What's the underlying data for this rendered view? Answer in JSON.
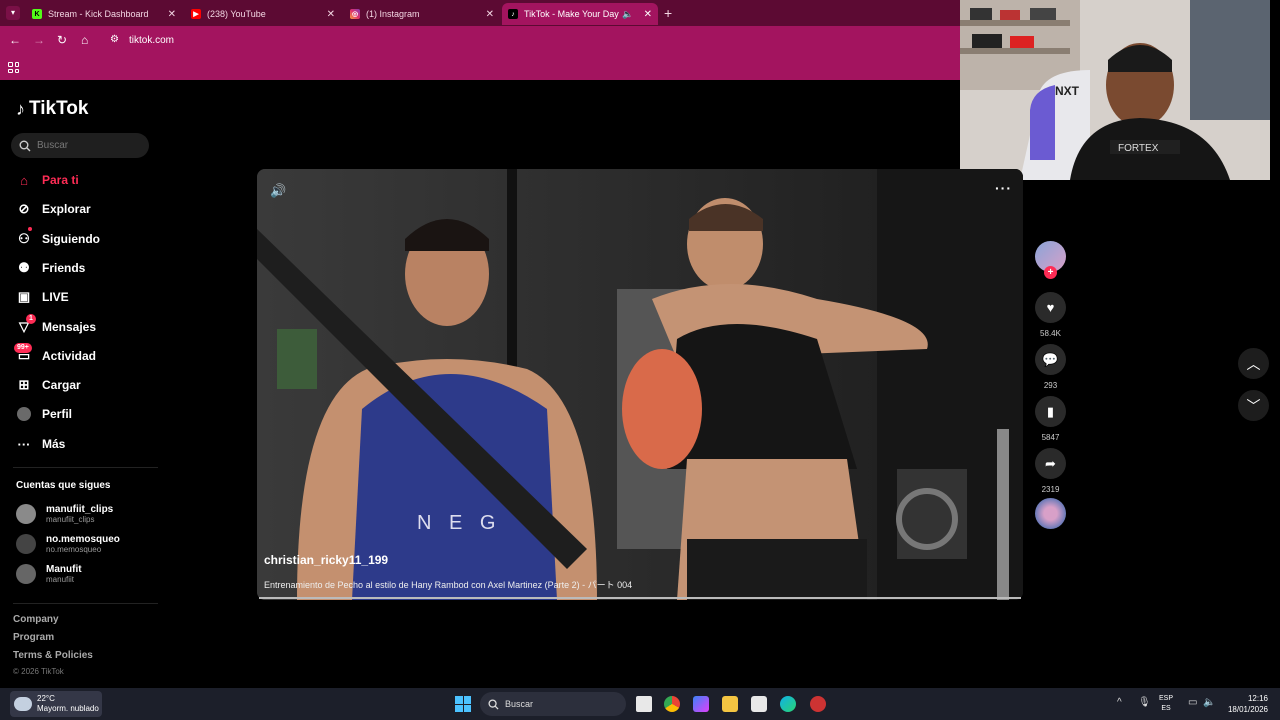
{
  "browser": {
    "tabs": [
      {
        "title": "Stream - Kick Dashboard",
        "icon": "kick-icon",
        "color": "#53fc18",
        "active": false
      },
      {
        "title": "(238) YouTube",
        "icon": "youtube-icon",
        "color": "#ff0000",
        "active": false
      },
      {
        "title": "(1) Instagram",
        "icon": "instagram-icon",
        "color": "#e1306c",
        "active": false
      },
      {
        "title": "TikTok - Make Your Day",
        "icon": "tiktok-icon",
        "color": "#000000",
        "active": true
      }
    ],
    "new_tab": "+",
    "address": "tiktok.com",
    "accent": "#a3145f"
  },
  "sidebar": {
    "logo": "TikTok",
    "search_placeholder": "Buscar",
    "nav": [
      {
        "label": "Para ti",
        "icon": "home-icon"
      },
      {
        "label": "Explorar",
        "icon": "compass-icon"
      },
      {
        "label": "Siguiendo",
        "icon": "following-icon"
      },
      {
        "label": "Friends",
        "icon": "friends-icon"
      },
      {
        "label": "LIVE",
        "icon": "live-icon"
      },
      {
        "label": "Mensajes",
        "icon": "messages-icon",
        "badge": "1"
      },
      {
        "label": "Actividad",
        "icon": "activity-icon",
        "badge": "99+"
      },
      {
        "label": "Cargar",
        "icon": "upload-icon"
      },
      {
        "label": "Perfil",
        "icon": "profile-icon"
      },
      {
        "label": "Más",
        "icon": "more-icon"
      }
    ],
    "following_title": "Cuentas que sigues",
    "following": [
      {
        "name": "manufiit_clips",
        "username": "manufiit_clips"
      },
      {
        "name": "no.memosqueo",
        "username": "no.memosqueo"
      },
      {
        "name": "Manufit",
        "username": "manufiit"
      }
    ],
    "footer": [
      "Company",
      "Program",
      "Terms & Policies"
    ],
    "copyright": "© 2026 TikTok"
  },
  "video": {
    "author": "christian_ricky11_199",
    "caption": "Entrenamiento de Pecho al estilo de Hany Rambod con Axel Martinez (Parte 2) - パート 004",
    "progress": 1.0
  },
  "actions": {
    "likes": "58.4K",
    "comments": "293",
    "saves": "5847",
    "shares": "2319"
  },
  "taskbar": {
    "weather_temp": "22°C",
    "weather_desc": "Mayorm. nublado",
    "search": "Buscar",
    "lang_top": "ESP",
    "lang_bottom": "ES",
    "time": "12:16",
    "date": "18/01/2026"
  }
}
